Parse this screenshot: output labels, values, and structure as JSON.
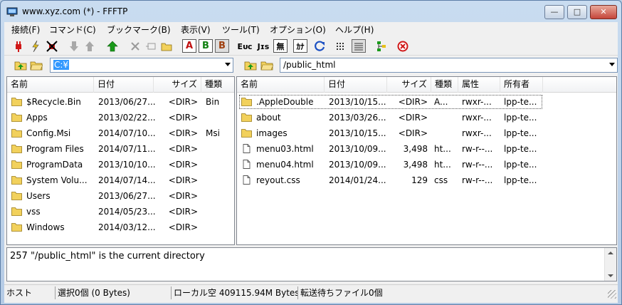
{
  "window": {
    "title": "www.xyz.com (*) - FFFTP",
    "minimize_label": "—",
    "maximize_label": "□",
    "close_label": "✕"
  },
  "menu": [
    {
      "label": "接続(F)"
    },
    {
      "label": "コマンド(C)"
    },
    {
      "label": "ブックマーク(B)"
    },
    {
      "label": "表示(V)"
    },
    {
      "label": "ツール(T)"
    },
    {
      "label": "オプション(O)"
    },
    {
      "label": "ヘルプ(H)"
    }
  ],
  "toolbar": {
    "ascii_label": "A",
    "binary_label": "B",
    "auto_label": "B",
    "ex_label": "Eᴜᴄ",
    "jis_label": "Jɪs",
    "none_label": "無",
    "kana_label": "ｶﾅ"
  },
  "colors": {
    "connect_red": "#d01818",
    "upload_green": "#1a9a1a",
    "folder_yellow": "#f2d15c",
    "selection_blue": "#3399ff"
  },
  "local": {
    "path": "C:¥",
    "columns": [
      "名前",
      "日付",
      "サイズ",
      "種類"
    ],
    "files": [
      {
        "name": "$Recycle.Bin",
        "date": "2013/06/27...",
        "size": "<DIR>",
        "type": "Bin",
        "icon": "folder-icon"
      },
      {
        "name": "Apps",
        "date": "2013/02/22...",
        "size": "<DIR>",
        "type": "",
        "icon": "folder-icon"
      },
      {
        "name": "Config.Msi",
        "date": "2014/07/10...",
        "size": "<DIR>",
        "type": "Msi",
        "icon": "folder-icon"
      },
      {
        "name": "Program Files",
        "date": "2014/07/11...",
        "size": "<DIR>",
        "type": "",
        "icon": "folder-icon"
      },
      {
        "name": "ProgramData",
        "date": "2013/10/10...",
        "size": "<DIR>",
        "type": "",
        "icon": "folder-icon"
      },
      {
        "name": "System Volu...",
        "date": "2014/07/14...",
        "size": "<DIR>",
        "type": "",
        "icon": "folder-icon"
      },
      {
        "name": "Users",
        "date": "2013/06/27...",
        "size": "<DIR>",
        "type": "",
        "icon": "folder-icon"
      },
      {
        "name": "vss",
        "date": "2014/05/23...",
        "size": "<DIR>",
        "type": "",
        "icon": "folder-icon"
      },
      {
        "name": "Windows",
        "date": "2014/03/12...",
        "size": "<DIR>",
        "type": "",
        "icon": "folder-icon"
      }
    ]
  },
  "remote": {
    "path": "/public_html",
    "columns": [
      "名前",
      "日付",
      "サイズ",
      "種類",
      "属性",
      "所有者"
    ],
    "files": [
      {
        "name": ".AppleDouble",
        "date": "2013/10/15...",
        "size": "<DIR>",
        "type": "A...",
        "attr": "rwxr-...",
        "owner": "lpp-te...",
        "icon": "folder-icon"
      },
      {
        "name": "about",
        "date": "2013/03/26...",
        "size": "<DIR>",
        "type": "",
        "attr": "rwxr-...",
        "owner": "lpp-te...",
        "icon": "folder-icon"
      },
      {
        "name": "images",
        "date": "2013/10/15...",
        "size": "<DIR>",
        "type": "",
        "attr": "rwxr-...",
        "owner": "lpp-te...",
        "icon": "folder-icon"
      },
      {
        "name": "menu03.html",
        "date": "2013/10/09...",
        "size": "3,498",
        "type": "ht...",
        "attr": "rw-r--...",
        "owner": "lpp-te...",
        "icon": "file-icon"
      },
      {
        "name": "menu04.html",
        "date": "2013/10/09...",
        "size": "3,498",
        "type": "ht...",
        "attr": "rw-r--...",
        "owner": "lpp-te...",
        "icon": "file-icon"
      },
      {
        "name": "reyout.css",
        "date": "2014/01/24...",
        "size": "129",
        "type": "css",
        "attr": "rw-r--...",
        "owner": "lpp-te...",
        "icon": "file-icon"
      }
    ]
  },
  "log": {
    "message": "257 \"/public_html\" is the current directory"
  },
  "status": {
    "host": "ホスト",
    "selection": "選択0個  (0 Bytes)",
    "local_free": "ローカル空 409115.94M Bytes",
    "queue": "転送待ちファイル0個"
  }
}
